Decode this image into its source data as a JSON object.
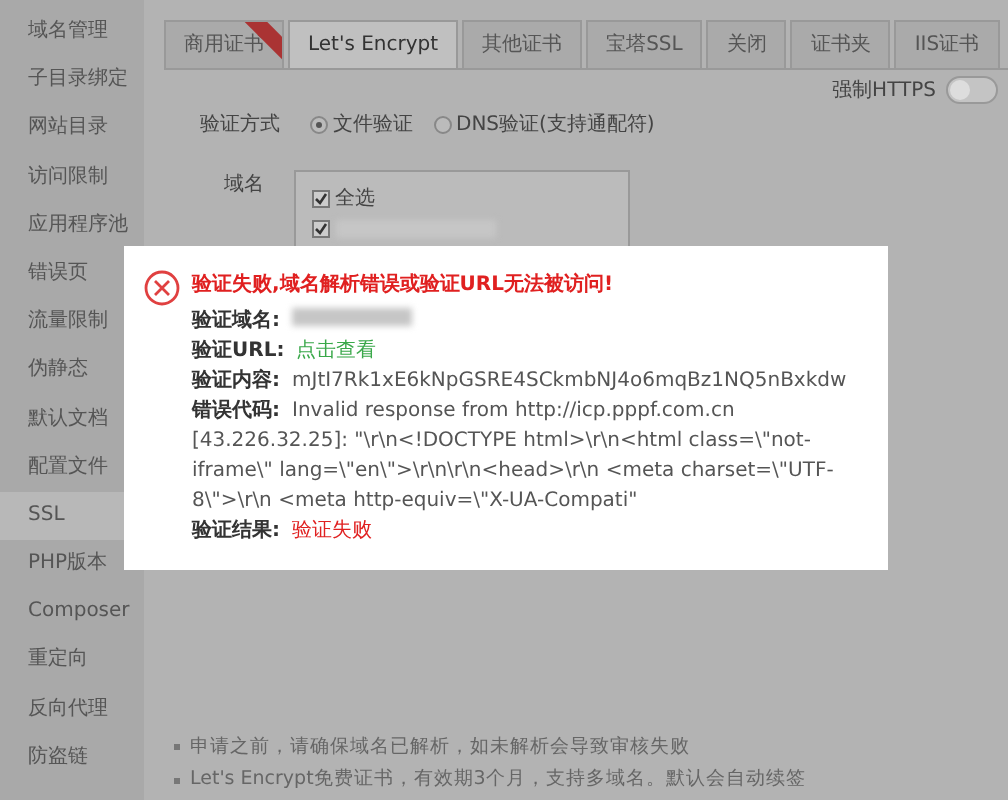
{
  "sidebar": {
    "items": [
      {
        "label": "域名管理",
        "selected": false
      },
      {
        "label": "子目录绑定",
        "selected": false
      },
      {
        "label": "网站目录",
        "selected": false
      },
      {
        "label": "访问限制",
        "selected": false
      },
      {
        "label": "应用程序池",
        "selected": false
      },
      {
        "label": "错误页",
        "selected": false
      },
      {
        "label": "流量限制",
        "selected": false
      },
      {
        "label": "伪静态",
        "selected": false
      },
      {
        "label": "默认文档",
        "selected": false
      },
      {
        "label": "配置文件",
        "selected": false
      },
      {
        "label": "SSL",
        "selected": true
      },
      {
        "label": "PHP版本",
        "selected": false
      },
      {
        "label": "Composer",
        "selected": false
      },
      {
        "label": "重定向",
        "selected": false
      },
      {
        "label": "反向代理",
        "selected": false
      },
      {
        "label": "防盗链",
        "selected": false
      }
    ]
  },
  "tabs": [
    {
      "label": "商用证书",
      "selected": false,
      "ribbon": true
    },
    {
      "label": "Let's Encrypt",
      "selected": true,
      "ribbon": false
    },
    {
      "label": "其他证书",
      "selected": false,
      "ribbon": false
    },
    {
      "label": "宝塔SSL",
      "selected": false,
      "ribbon": false
    },
    {
      "label": "关闭",
      "selected": false,
      "ribbon": false
    },
    {
      "label": "证书夹",
      "selected": false,
      "ribbon": false
    },
    {
      "label": "IIS证书",
      "selected": false,
      "ribbon": false
    }
  ],
  "force_https": {
    "label": "强制HTTPS",
    "on": false
  },
  "verify_method": {
    "label": "验证方式",
    "options": [
      {
        "label": "文件验证",
        "selected": true
      },
      {
        "label": "DNS验证(支持通配符)",
        "selected": false
      }
    ]
  },
  "domains": {
    "label": "域名",
    "items": [
      {
        "kind": "text",
        "label": "全选",
        "checked": true
      },
      {
        "kind": "redacted",
        "checked": true
      }
    ]
  },
  "dialog": {
    "title": "验证失败,域名解析错误或验证URL无法被访问!",
    "fields": [
      {
        "kind": "redacted",
        "key": "验证域名:"
      },
      {
        "kind": "link",
        "key": "验证URL:",
        "value": "点击查看"
      },
      {
        "kind": "text",
        "key": "验证内容:",
        "value": "mJtI7Rk1xE6kNpGSRE4SCkmbNJ4o6mqBz1NQ5nBxkdw"
      },
      {
        "kind": "text",
        "key": "错误代码:",
        "value": "Invalid response from http://icp.pppf.com.cn [43.226.32.25]: \"\\r\\n<!DOCTYPE html>\\r\\n<html class=\\\"not-iframe\\\" lang=\\\"en\\\">\\r\\n\\r\\n<head>\\r\\n <meta charset=\\\"UTF-8\\\">\\r\\n <meta http-equiv=\\\"X-UA-Compati\""
      },
      {
        "kind": "error",
        "key": "验证结果:",
        "value": "验证失败"
      }
    ]
  },
  "notes": [
    "申请之前，请确保域名已解析，如未解析会导致审核失败",
    "Let's Encrypt免费证书，有效期3个月，支持多域名。默认会自动续签"
  ]
}
